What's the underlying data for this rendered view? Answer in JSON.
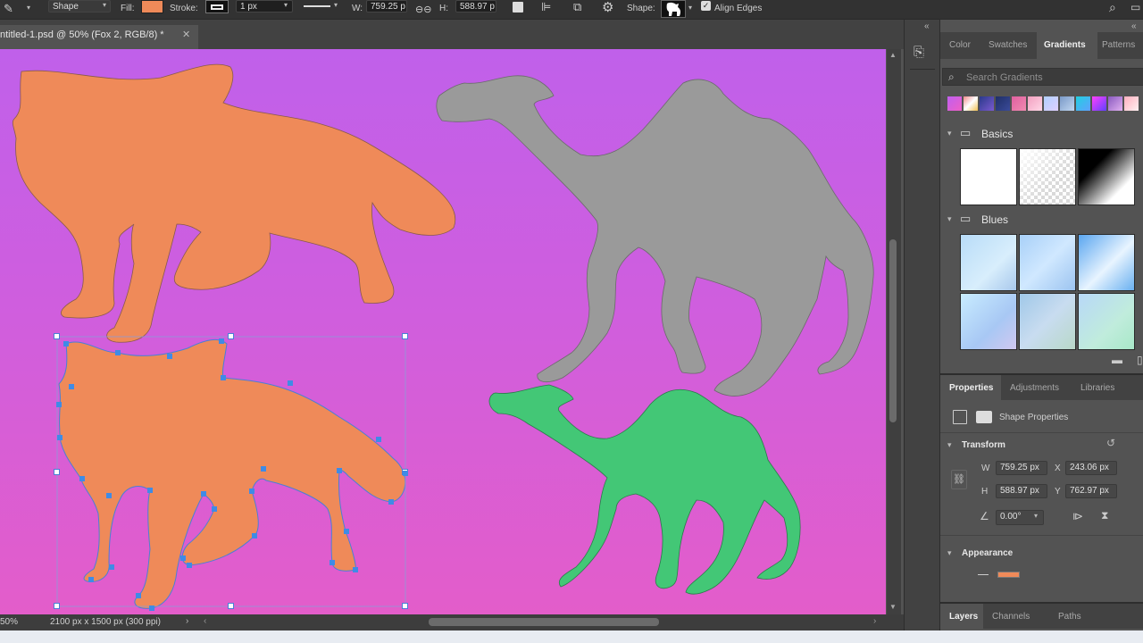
{
  "options_bar": {
    "mode": "Shape",
    "fill_label": "Fill:",
    "fill_color": "#ef8a59",
    "stroke_label": "Stroke:",
    "stroke_width": "1 px",
    "width_label": "W:",
    "width_value": "759.25 p",
    "height_label": "H:",
    "height_value": "588.97 p",
    "shape_label": "Shape:",
    "align_edges_label": "Align Edges",
    "align_edges_checked": true
  },
  "document": {
    "tab_title": "ntitled-1.psd @ 50% (Fox 2, RGB/8) *",
    "zoom": "50%",
    "doc_info": "2100 px x 1500 px (300 ppi)"
  },
  "canvas": {
    "shapes": [
      {
        "name": "Fox",
        "color": "#ef8a59"
      },
      {
        "name": "Fox 2",
        "color": "#ef8a59",
        "selected": true
      },
      {
        "name": "Camel",
        "color": "#9a9a9a"
      },
      {
        "name": "Camel 2",
        "color": "#43c776"
      }
    ]
  },
  "gradients_panel": {
    "tabs": [
      "Color",
      "Swatches",
      "Gradients",
      "Patterns"
    ],
    "active_tab": "Gradients",
    "search_placeholder": "Search Gradients",
    "groups": [
      {
        "name": "Basics",
        "items": [
          "white",
          "transparent",
          "black-white"
        ]
      },
      {
        "name": "Blues",
        "items": [
          "blue-1",
          "blue-2",
          "blue-3",
          "blue-4",
          "blue-5",
          "blue-6"
        ]
      }
    ]
  },
  "properties_panel": {
    "tabs": [
      "Properties",
      "Adjustments",
      "Libraries"
    ],
    "active_tab": "Properties",
    "subtitle": "Shape Properties",
    "transform_label": "Transform",
    "w_label": "W",
    "w_value": "759.25 px",
    "x_label": "X",
    "x_value": "243.06 px",
    "h_label": "H",
    "h_value": "588.97 px",
    "y_label": "Y",
    "y_value": "762.97 px",
    "angle_value": "0.00°",
    "appearance_label": "Appearance",
    "appearance_fill": "#ef8a59"
  },
  "layers_panel": {
    "tabs": [
      "Layers",
      "Channels",
      "Paths"
    ],
    "active_tab": "Layers"
  },
  "colors": {
    "panel_bg": "#535353",
    "bar_bg": "#323232",
    "selection": "#4a7fd6"
  }
}
